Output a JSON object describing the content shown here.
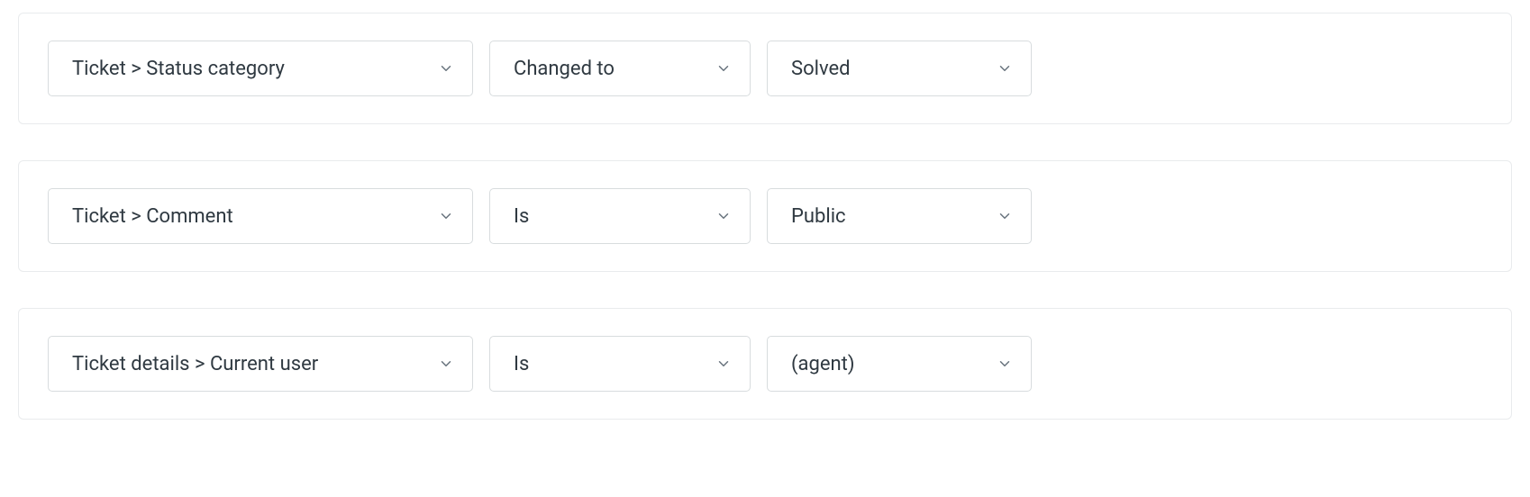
{
  "conditions": [
    {
      "field": "Ticket > Status category",
      "operator": "Changed to",
      "value": "Solved"
    },
    {
      "field": "Ticket > Comment",
      "operator": "Is",
      "value": "Public"
    },
    {
      "field": "Ticket details > Current user",
      "operator": "Is",
      "value": "(agent)"
    }
  ]
}
